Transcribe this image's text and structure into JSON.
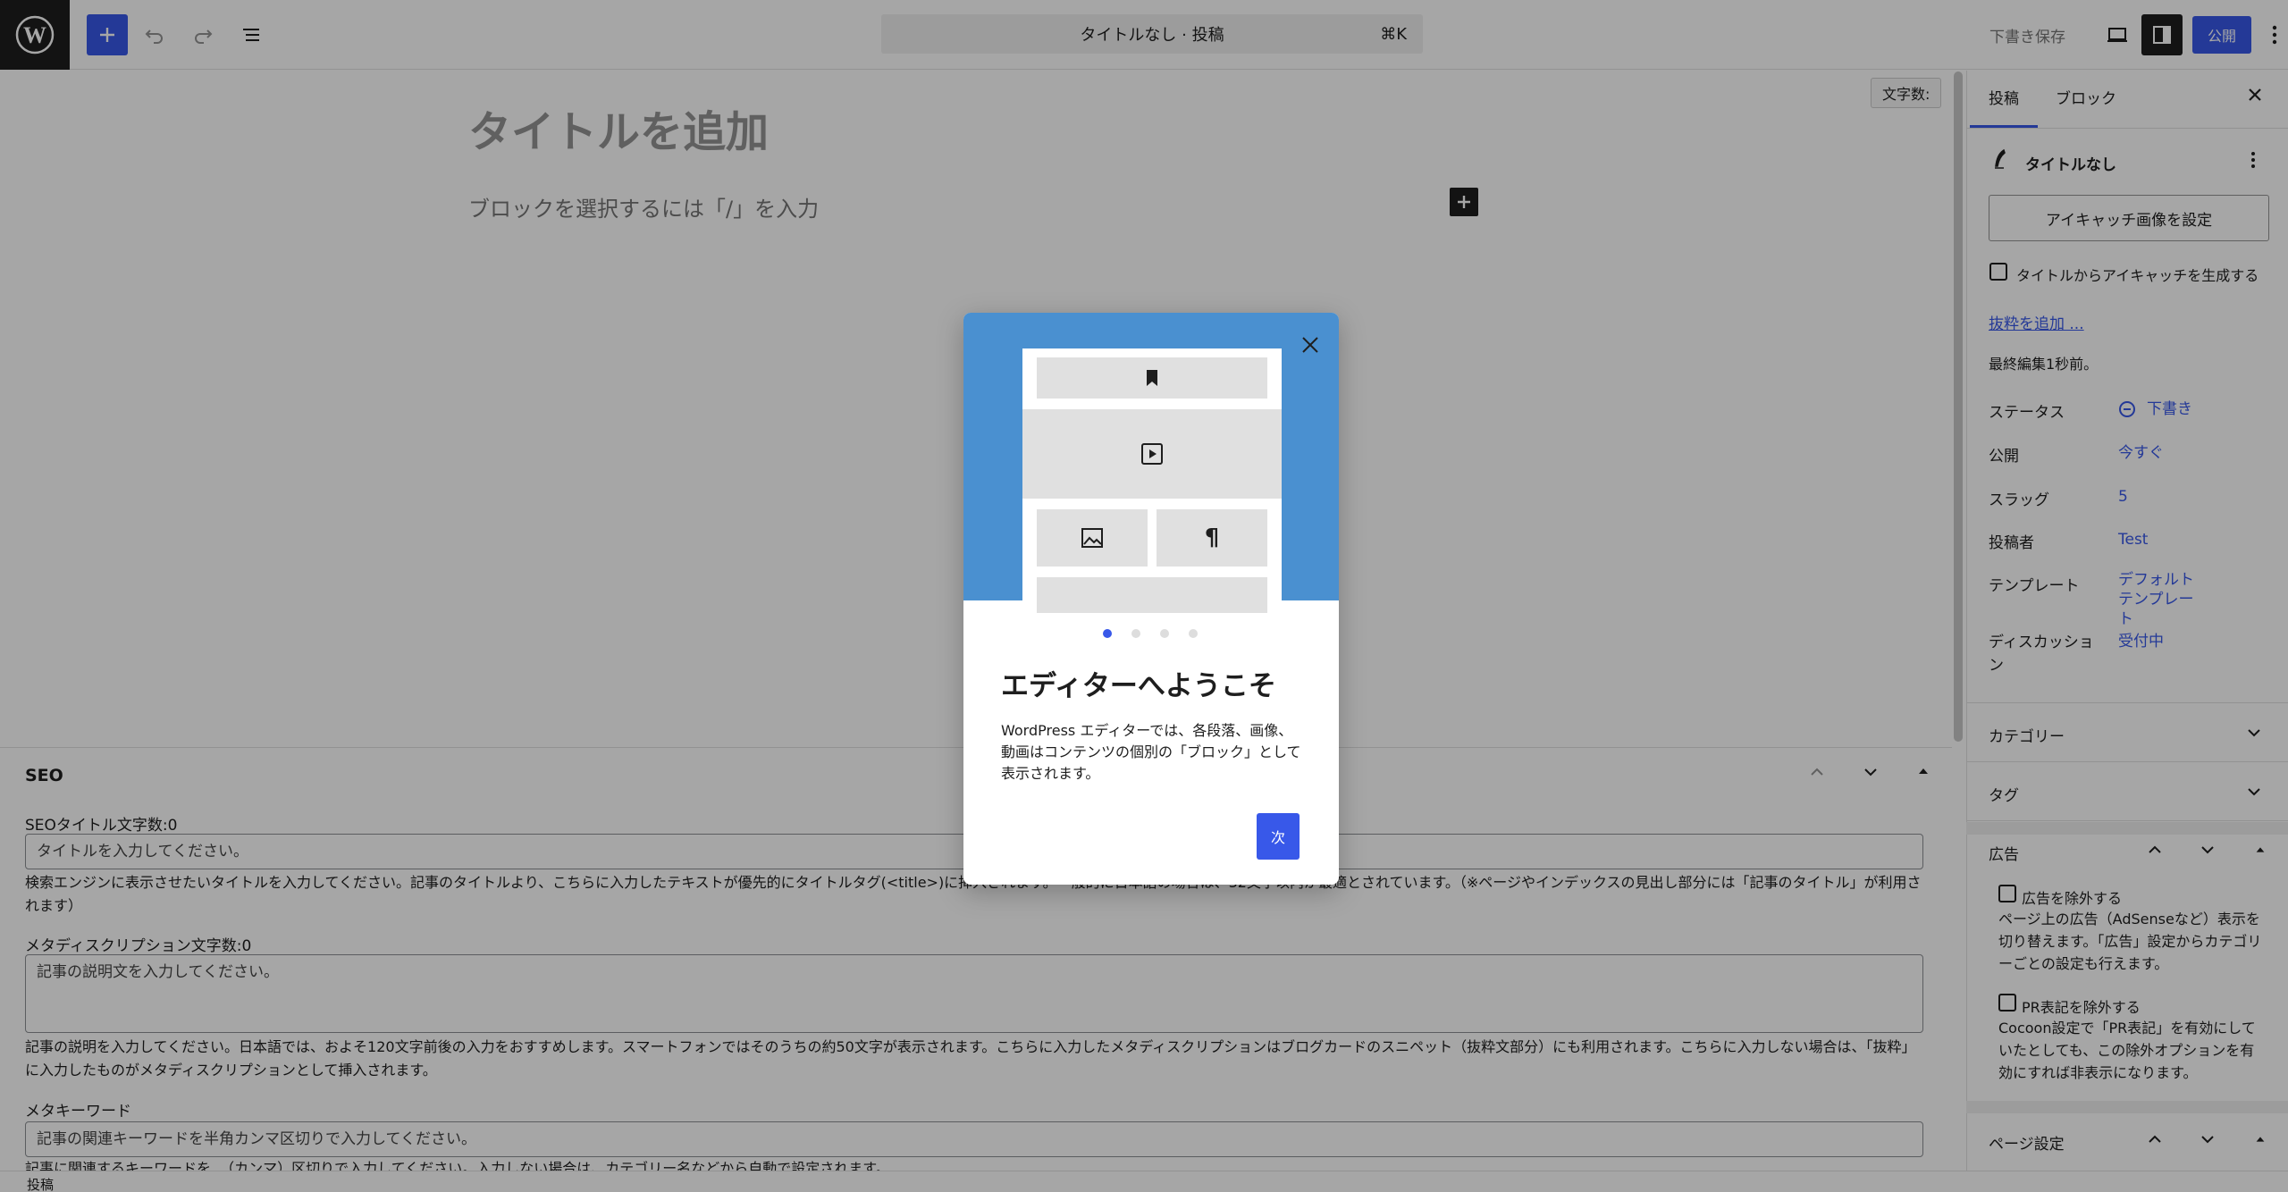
{
  "topbar": {
    "command_title": "タイトルなし · 投稿",
    "command_shortcut": "⌘K",
    "save_draft": "下書き保存",
    "publish": "公開"
  },
  "editor": {
    "word_count": "文字数:",
    "title_placeholder": "タイトルを追加",
    "block_placeholder": "ブロックを選択するには「/」を入力"
  },
  "seo": {
    "heading": "SEO",
    "title_label": "SEOタイトル文字数:0",
    "title_placeholder": "タイトルを入力してください。",
    "title_help": "検索エンジンに表示させたいタイトルを入力してください。記事のタイトルより、こちらに入力したテキストが優先的にタイトルタグ(<title>)に挿入されます。一般的に日本語の場合は、32文字以内が最適とされています。（※ページやインデックスの見出し部分には「記事のタイトル」が利用されます）",
    "desc_label": "メタディスクリプション文字数:0",
    "desc_placeholder": "記事の説明文を入力してください。",
    "desc_help": "記事の説明を入力してください。日本語では、およそ120文字前後の入力をおすすめします。スマートフォンではそのうちの約50文字が表示されます。こちらに入力したメタディスクリプションはブログカードのスニペット（抜粋文部分）にも利用されます。こちらに入力しない場合は、「抜粋」に入力したものがメタディスクリプションとして挿入されます。",
    "keyword_label": "メタキーワード",
    "keyword_placeholder": "記事の関連キーワードを半角カンマ区切りで入力してください。",
    "keyword_help": "記事に関連するキーワードを ,（カンマ）区切りで入力してください。入力しない場合は、カテゴリー名などから自動で設定されます。"
  },
  "status_bar": "投稿",
  "sidebar": {
    "tab_post": "投稿",
    "tab_block": "ブロック",
    "post_title": "タイトルなし",
    "featured_button": "アイキャッチ画像を設定",
    "auto_featured": "タイトルからアイキャッチを生成する",
    "excerpt_link": "抜粋を追加 ...",
    "last_edited": "最終編集1秒前。",
    "rows": [
      {
        "label": "ステータス",
        "value": "下書き"
      },
      {
        "label": "公開",
        "value": "今すぐ"
      },
      {
        "label": "スラッグ",
        "value": "5"
      },
      {
        "label": "投稿者",
        "value": "Test"
      },
      {
        "label": "テンプレート",
        "value": "デフォルトテンプレート"
      },
      {
        "label": "ディスカッション",
        "value": "受付中"
      }
    ],
    "category": "カテゴリー",
    "tag": "タグ",
    "ads_heading": "広告",
    "ads_exclude": "広告を除外する",
    "ads_help": "ページ上の広告（AdSenseなど）表示を切り替えます。「広告」設定からカテゴリーごとの設定も行えます。",
    "pr_exclude": "PR表記を除外する",
    "pr_help": "Cocoon設定で「PR表記」を有効にしていたとしても、この除外オプションを有効にすれば非表示になります。",
    "page_settings": "ページ設定"
  },
  "modal": {
    "title": "エディターへようこそ",
    "text": "WordPress エディターでは、各段落、画像、動画はコンテンツの個別の「ブロック」として表示されます。",
    "next": "次",
    "page_count": 4,
    "current_page": 1
  }
}
